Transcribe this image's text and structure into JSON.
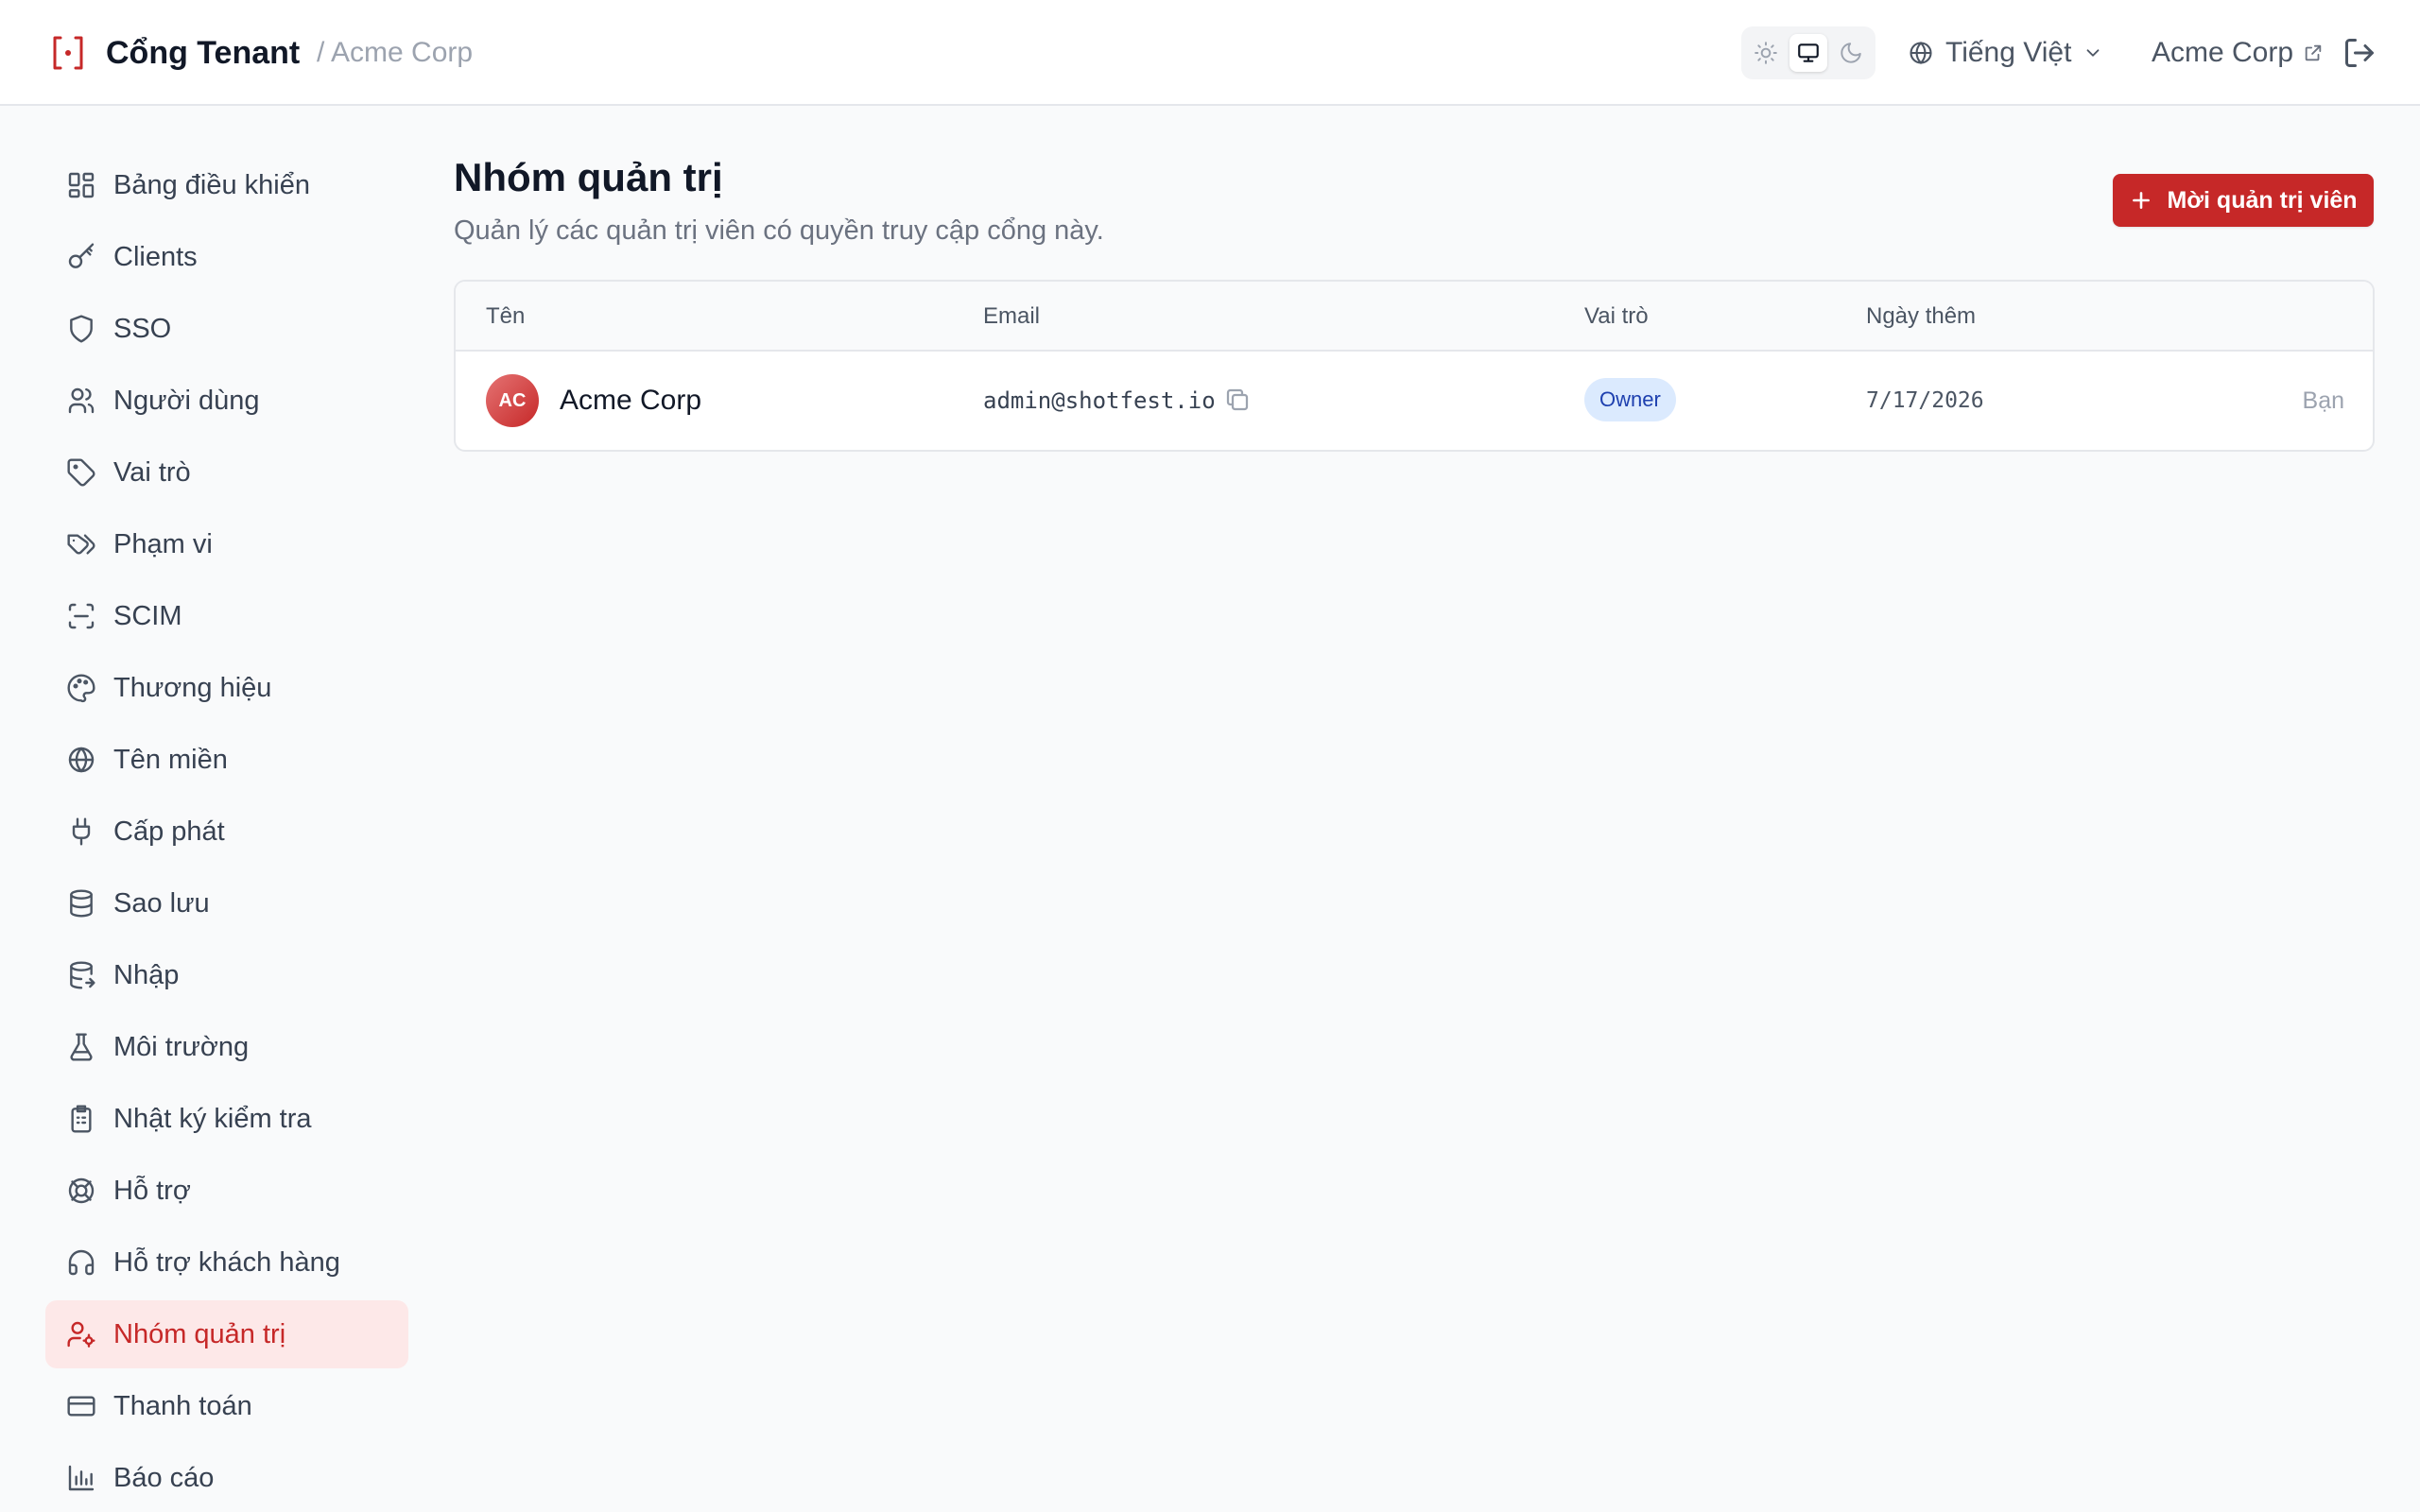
{
  "header": {
    "app_title": "Cổng Tenant",
    "breadcrumb": "/ Acme Corp",
    "language": "Tiếng Việt",
    "tenant_name": "Acme Corp",
    "theme_modes": [
      "light",
      "system",
      "dark"
    ],
    "active_theme": "system"
  },
  "sidebar": {
    "items": [
      {
        "label": "Bảng điều khiển",
        "icon": "dashboard-icon"
      },
      {
        "label": "Clients",
        "icon": "key-icon"
      },
      {
        "label": "SSO",
        "icon": "shield-icon"
      },
      {
        "label": "Người dùng",
        "icon": "users-icon"
      },
      {
        "label": "Vai trò",
        "icon": "tag-icon"
      },
      {
        "label": "Phạm vi",
        "icon": "tags-icon"
      },
      {
        "label": "SCIM",
        "icon": "scan-icon"
      },
      {
        "label": "Thương hiệu",
        "icon": "palette-icon"
      },
      {
        "label": "Tên miền",
        "icon": "globe-icon"
      },
      {
        "label": "Cấp phát",
        "icon": "plug-icon"
      },
      {
        "label": "Sao lưu",
        "icon": "database-icon"
      },
      {
        "label": "Nhập",
        "icon": "database-import-icon"
      },
      {
        "label": "Môi trường",
        "icon": "flask-icon"
      },
      {
        "label": "Nhật ký kiểm tra",
        "icon": "clipboard-icon"
      },
      {
        "label": "Hỗ trợ",
        "icon": "lifebuoy-icon"
      },
      {
        "label": "Hỗ trợ khách hàng",
        "icon": "headset-icon"
      },
      {
        "label": "Nhóm quản trị",
        "icon": "user-cog-icon"
      },
      {
        "label": "Thanh toán",
        "icon": "credit-card-icon"
      },
      {
        "label": "Báo cáo",
        "icon": "bar-chart-icon"
      }
    ],
    "active_index": 16
  },
  "main": {
    "title": "Nhóm quản trị",
    "subtitle": "Quản lý các quản trị viên có quyền truy cập cổng này.",
    "invite_button": "Mời quản trị viên",
    "accent_color": "#c62828",
    "table": {
      "columns": [
        "Tên",
        "Email",
        "Vai trò",
        "Ngày thêm"
      ],
      "rows": [
        {
          "initials": "AC",
          "name": "Acme Corp",
          "email": "admin@shotfest.io",
          "role": "Owner",
          "date_added": "7/17/2026",
          "self_label": "Bạn"
        }
      ]
    }
  }
}
